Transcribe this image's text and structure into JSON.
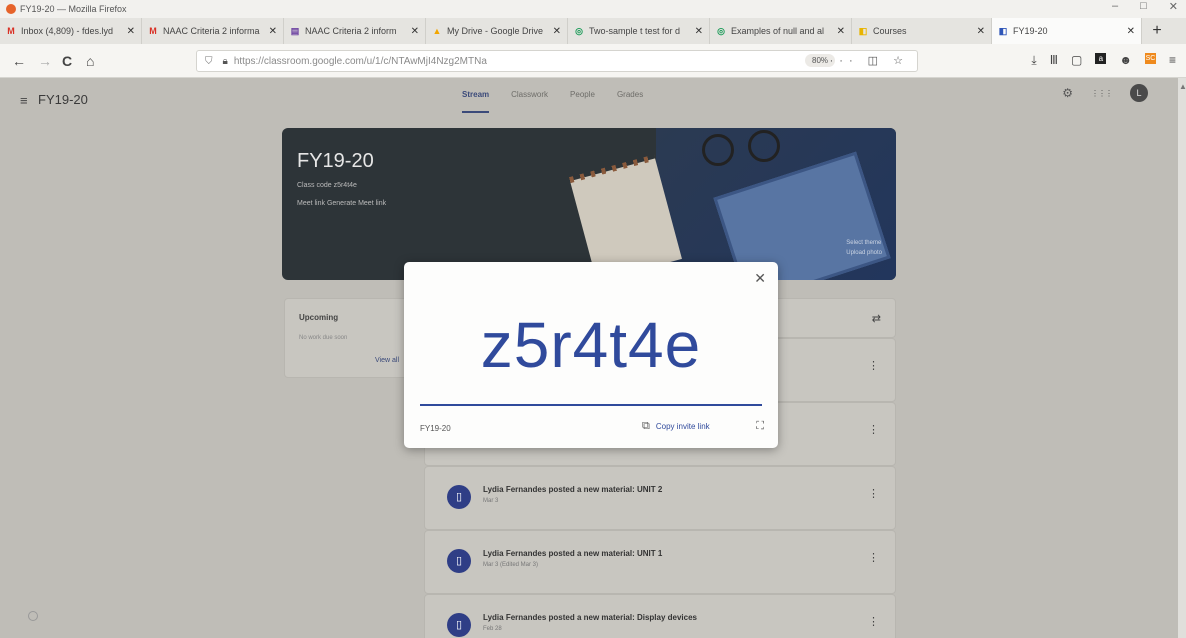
{
  "window": {
    "title": "FY19-20 — Mozilla Firefox",
    "minimize": "–",
    "maximize": "□",
    "close": "✕"
  },
  "tabs": [
    {
      "label": "Inbox (4,809) - fdes.lyd",
      "icon": "M",
      "color": "#d93025"
    },
    {
      "label": "NAAC Criteria 2 informa",
      "icon": "M",
      "color": "#d93025"
    },
    {
      "label": "NAAC Criteria 2 inform",
      "icon": "▤",
      "color": "#6b3fa0"
    },
    {
      "label": "My Drive - Google Drive",
      "icon": "▲",
      "color": "#f2a600"
    },
    {
      "label": "Two-sample t test for d",
      "icon": "◎",
      "color": "#1e9c5a"
    },
    {
      "label": "Examples of null and al",
      "icon": "◎",
      "color": "#1e9c5a"
    },
    {
      "label": "Courses",
      "icon": "◧",
      "color": "#e8b400"
    },
    {
      "label": "FY19-20",
      "icon": "◧",
      "color": "#2f56b8"
    }
  ],
  "tab_close": "✕",
  "new_tab": "+",
  "nav": {
    "back": "←",
    "forward": "→",
    "reload": "C",
    "home": "⌂"
  },
  "url": "https://classroom.google.com/u/1/c/NTAwMjI4Nzg2MTNa",
  "zoom": "80%",
  "url_icons": "··· ◫ ☆",
  "toolbar_icons": {
    "download": "⤓",
    "library": "Ⅲ",
    "sidebar": "▢",
    "amazon": "a",
    "account": "☻",
    "ext": "SC",
    "menu": "≡"
  },
  "classroom": {
    "menu_icon": "≡",
    "class_name": "FY19-20",
    "tabs": [
      "Stream",
      "Classwork",
      "People",
      "Grades"
    ],
    "settings_icon": "⚙",
    "apps_icon": "⋮⋮⋮",
    "avatar": "L",
    "banner": {
      "title": "FY19-20",
      "class_code_label": "Class code z5r4t4e",
      "meet_label": "Meet link Generate Meet link",
      "select_theme": "Select theme",
      "upload_photo": "Upload photo"
    },
    "upcoming": {
      "title": "Upcoming",
      "text": "No work due soon",
      "view_all": "View all"
    },
    "posts": [
      {
        "text": "Lydia Fernandes posted a new material: UNIT 2",
        "date": "Mar 3"
      },
      {
        "text": "Lydia Fernandes posted a new material: UNIT 1",
        "date": "Mar 3 (Edited Mar 3)"
      },
      {
        "text": "Lydia Fernandes posted a new material: Display devices",
        "date": "Feb 28"
      }
    ]
  },
  "modal": {
    "code": "z5r4t4e",
    "class_name": "FY19-20",
    "copy_link": "Copy invite link",
    "close": "✕",
    "fullscreen": "⛶"
  }
}
